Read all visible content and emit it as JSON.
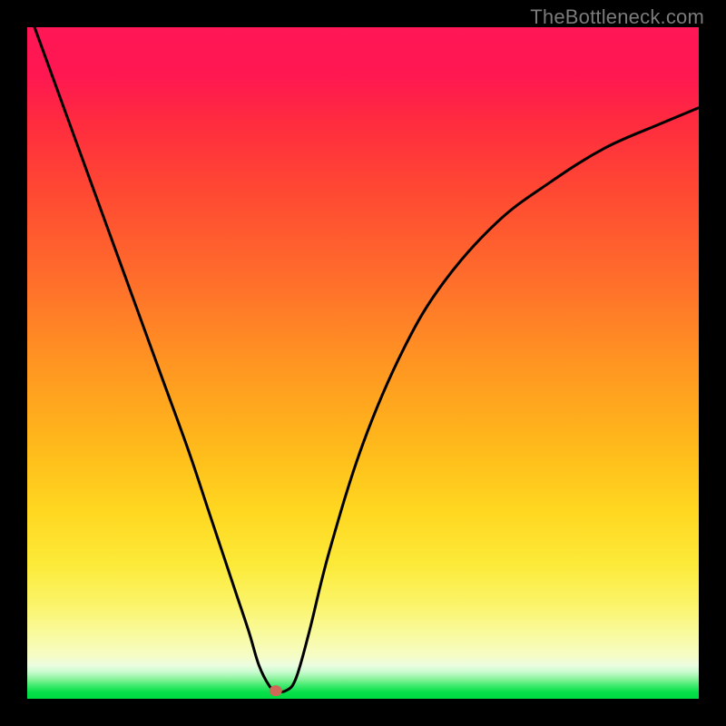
{
  "credit": "TheBottleneck.com",
  "colors": {
    "curve_stroke": "#000000",
    "marker_fill": "#d06858",
    "background": "#000000"
  },
  "chart_data": {
    "type": "line",
    "title": "",
    "xlabel": "",
    "ylabel": "",
    "xlim": [
      0,
      100
    ],
    "ylim": [
      0,
      100
    ],
    "grid": false,
    "legend": false,
    "series": [
      {
        "name": "bottleneck-curve",
        "x": [
          0,
          4,
          8,
          12,
          16,
          20,
          24,
          27,
          29,
          31,
          33,
          34.5,
          36,
          37,
          38.5,
          40,
          42,
          45,
          50,
          56,
          62,
          70,
          78,
          86,
          94,
          100
        ],
        "y": [
          103,
          92,
          81,
          70,
          59,
          48,
          37,
          28,
          22,
          16,
          10,
          5,
          2,
          1.2,
          1.2,
          3,
          10,
          22,
          38,
          52,
          62,
          71,
          77,
          82,
          85.5,
          88
        ]
      }
    ],
    "annotations": [
      {
        "name": "bottleneck-marker",
        "x": 37,
        "y": 1.2,
        "shape": "ellipse"
      }
    ]
  }
}
